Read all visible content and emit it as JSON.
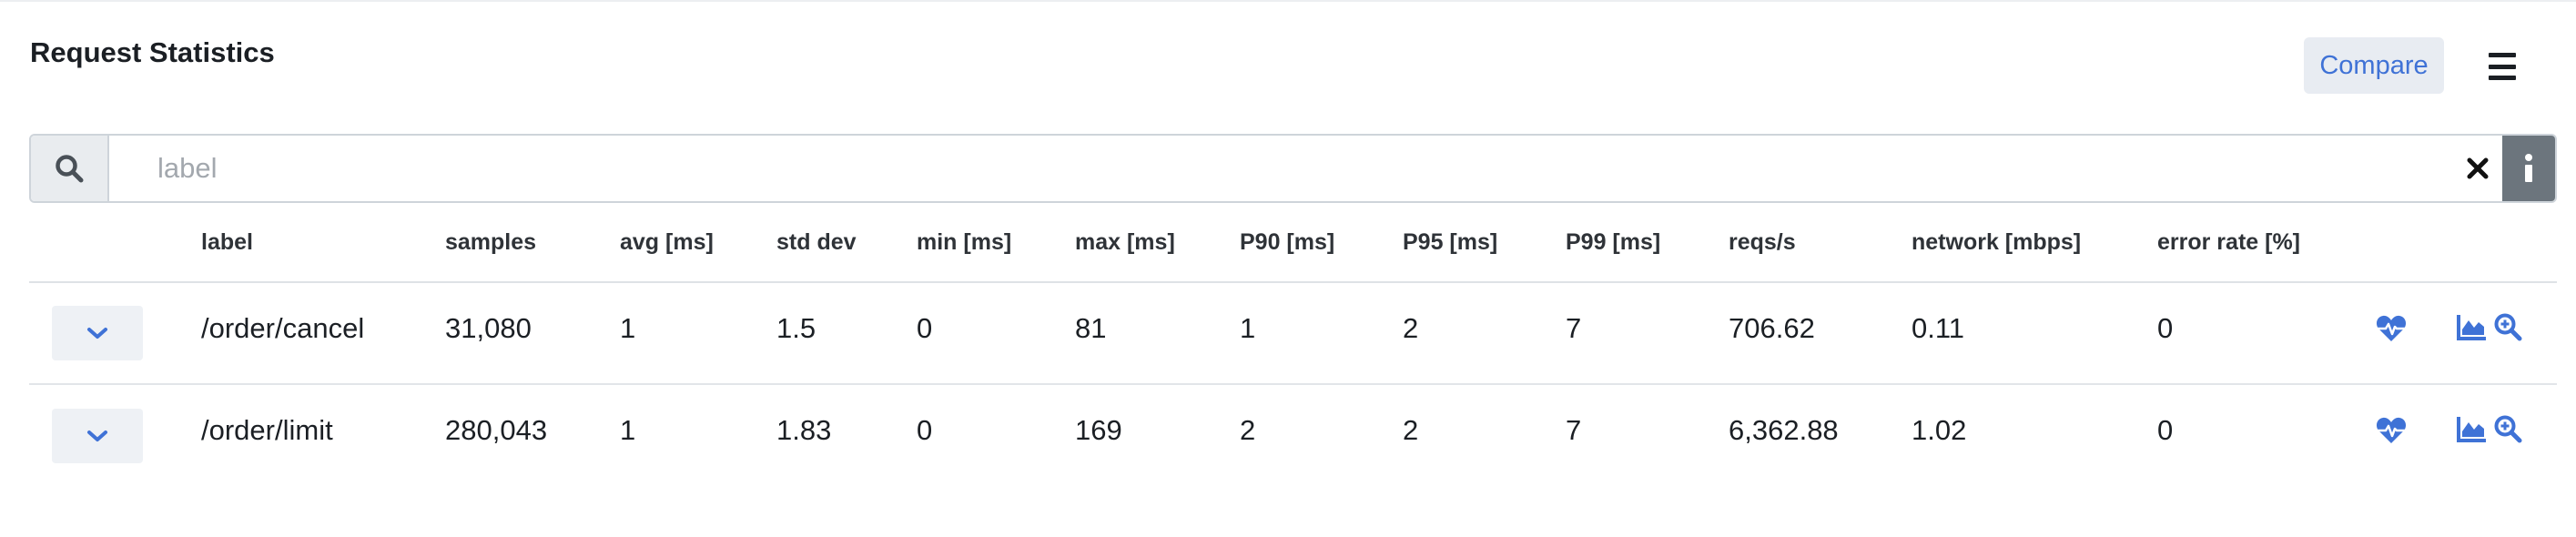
{
  "header": {
    "title": "Request Statistics",
    "compare_label": "Compare"
  },
  "search": {
    "placeholder": "label",
    "value": ""
  },
  "table": {
    "columns": [
      "label",
      "samples",
      "avg [ms]",
      "std dev",
      "min [ms]",
      "max [ms]",
      "P90 [ms]",
      "P95 [ms]",
      "P99 [ms]",
      "reqs/s",
      "network [mbps]",
      "error rate [%]"
    ],
    "rows": [
      [
        "/order/cancel",
        "31,080",
        "1",
        "1.5",
        "0",
        "81",
        "1",
        "2",
        "7",
        "706.62",
        "0.11",
        "0"
      ],
      [
        "/order/limit",
        "280,043",
        "1",
        "1.83",
        "0",
        "169",
        "2",
        "2",
        "7",
        "6,362.88",
        "1.02",
        "0"
      ]
    ]
  },
  "icons": {
    "search": "search-icon",
    "clear": "close-icon",
    "info": "info-icon",
    "menu": "hamburger-menu-icon",
    "expand": "chevron-down-icon",
    "health": "heartbeat-icon",
    "chart": "area-chart-icon",
    "zoom": "zoom-in-icon"
  },
  "colors": {
    "accent": "#3f72d6",
    "compare_bg": "#e8ecf2",
    "info_bg": "#6c757d"
  }
}
